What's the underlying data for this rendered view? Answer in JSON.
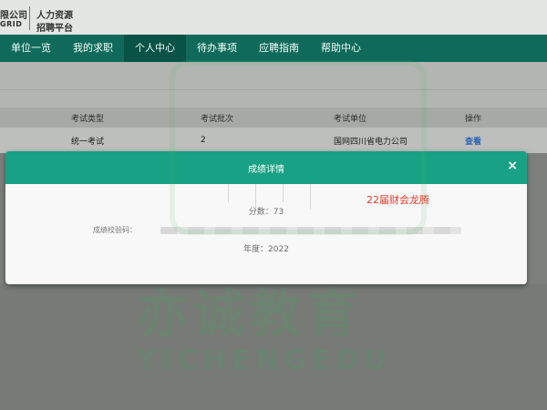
{
  "header": {
    "org_partial": "限公司",
    "org_sub": "GRID",
    "title_line1": "人力资源",
    "title_line2": "招聘平台"
  },
  "nav": {
    "items": [
      {
        "label": "单位一览",
        "active": false
      },
      {
        "label": "我的求职",
        "active": false
      },
      {
        "label": "个人中心",
        "active": true
      },
      {
        "label": "待办事项",
        "active": false
      },
      {
        "label": "应聘指南",
        "active": false
      },
      {
        "label": "帮助中心",
        "active": false
      }
    ]
  },
  "table": {
    "headers": [
      "考试类型",
      "考试批次",
      "考试单位",
      "操作"
    ],
    "rows": [
      {
        "type": "统一考试",
        "batch": "2",
        "unit": "国网四川省电力公司",
        "action": "查看"
      }
    ]
  },
  "modal": {
    "title": "成绩详情",
    "close_glyph": "×",
    "score_text": "分数：73",
    "verify_label": "成绩校验码：",
    "year_text": "年度：2022",
    "annotation": "22届财会龙腾"
  },
  "watermark": {
    "main": "亦诚教育",
    "sub": "YICHENGEDU"
  },
  "colors": {
    "nav_bg": "#0f6a5b",
    "modal_header": "#18a184",
    "link": "#2f64b8",
    "annotation": "#e03a2a"
  }
}
